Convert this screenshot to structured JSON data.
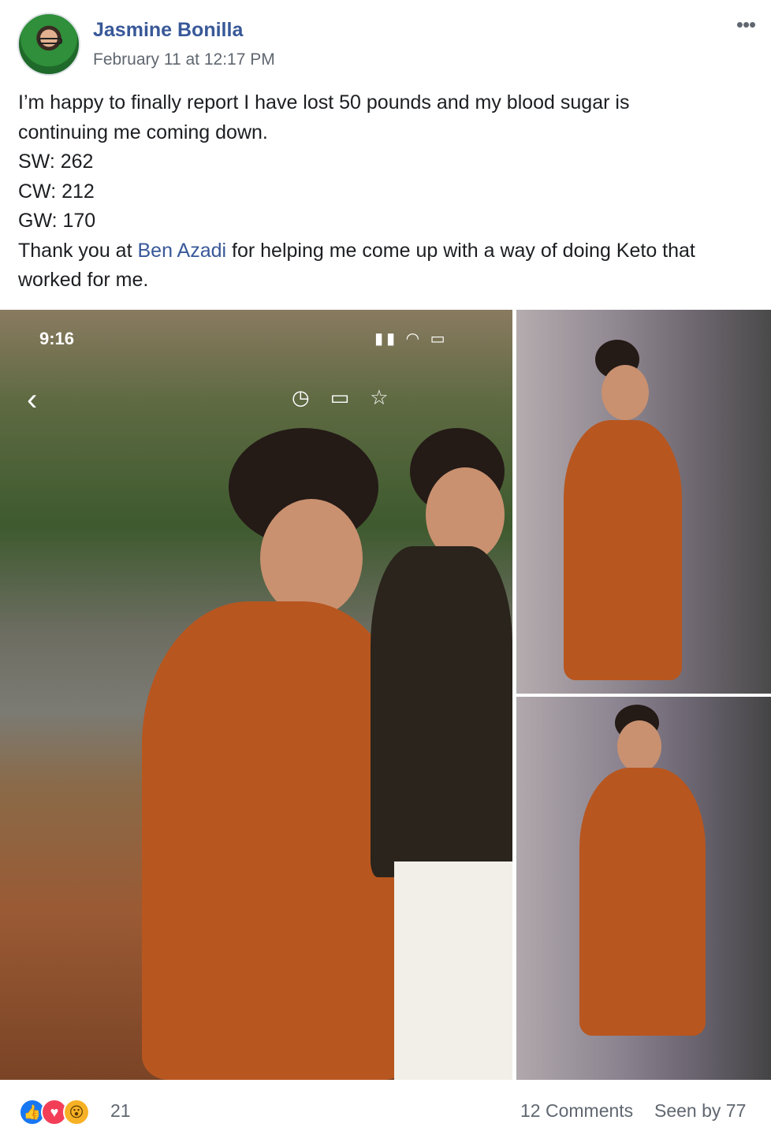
{
  "post": {
    "author": "Jasmine Bonilla",
    "timestamp": "February 11 at 12:17 PM",
    "more_label": "•••",
    "text_lines": [
      "I’m happy to finally report I have lost 50 pounds and my blood sugar is",
      "continuing me coming down.",
      "SW: 262",
      "CW: 212",
      "GW: 170"
    ],
    "thanks_prefix": "Thank you at ",
    "mention": "Ben Azadi",
    "thanks_suffix": " for helping me come up with a way of doing Keto that",
    "thanks_line2": "worked for me."
  },
  "photo": {
    "phone_time": "9:16",
    "back_icon": "chevron-left-icon"
  },
  "footer": {
    "reactions": [
      "like-icon",
      "love-icon",
      "wow-icon"
    ],
    "reaction_count": "21",
    "comments": "12 Comments",
    "seen_by": "Seen by 77"
  },
  "colors": {
    "link": "#385898",
    "muted": "#606770",
    "like": "#1877f2",
    "love": "#f33e58",
    "wow": "#f7b125"
  }
}
